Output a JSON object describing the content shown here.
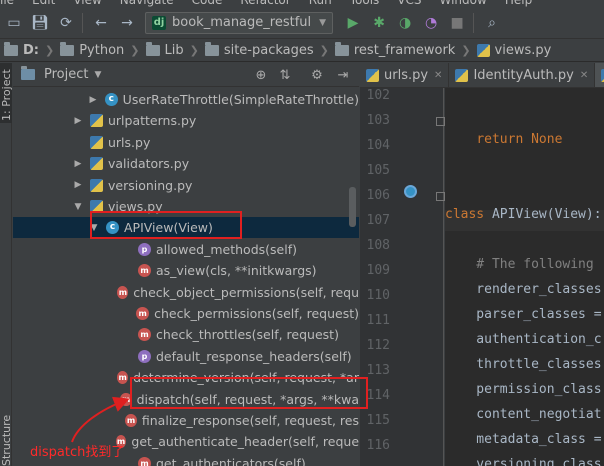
{
  "menubar": {
    "items": [
      "ile",
      "Edit",
      "View",
      "Navigate",
      "Code",
      "Refactor",
      "Run",
      "Tools",
      "VCS",
      "Window",
      "Help"
    ]
  },
  "toolbar": {
    "run_config": "book_manage_restful",
    "run_config_badge": "dj",
    "icons": [
      "save-icon",
      "sync-icon",
      "back-icon",
      "forward-icon",
      "run-icon",
      "debug-icon",
      "coverage-icon",
      "profile-icon",
      "stop-icon",
      "search-icon"
    ]
  },
  "breadcrumb": {
    "items": [
      "D:",
      "Python",
      "Lib",
      "site-packages",
      "rest_framework",
      "views.py"
    ]
  },
  "left_strip": {
    "top_tab": "1: Project",
    "bottom_tab": "Structure"
  },
  "project_panel": {
    "title": "Project",
    "tree": [
      {
        "label": "UserRateThrottle(SimpleRateThrottle)",
        "icon": "c",
        "indent": 108,
        "expander": "▶"
      },
      {
        "label": "urlpatterns.py",
        "icon": "py",
        "indent": 92,
        "expander": "▶"
      },
      {
        "label": "urls.py",
        "icon": "py",
        "indent": 92,
        "expander": ""
      },
      {
        "label": "validators.py",
        "icon": "py",
        "indent": 92,
        "expander": "▶"
      },
      {
        "label": "versioning.py",
        "icon": "py",
        "indent": 92,
        "expander": "▶"
      },
      {
        "label": "views.py",
        "icon": "py",
        "indent": 92,
        "expander": "▼"
      },
      {
        "label": "APIView(View)",
        "icon": "c",
        "indent": 108,
        "expander": "▼",
        "selected": true
      },
      {
        "label": "allowed_methods(self)",
        "icon": "p",
        "indent": 140,
        "expander": ""
      },
      {
        "label": "as_view(cls, **initkwargs)",
        "icon": "m",
        "indent": 140,
        "expander": ""
      },
      {
        "label": "check_object_permissions(self, requ",
        "icon": "m",
        "indent": 140,
        "expander": ""
      },
      {
        "label": "check_permissions(self, request)",
        "icon": "m",
        "indent": 140,
        "expander": ""
      },
      {
        "label": "check_throttles(self, request)",
        "icon": "m",
        "indent": 140,
        "expander": ""
      },
      {
        "label": "default_response_headers(self)",
        "icon": "p",
        "indent": 140,
        "expander": ""
      },
      {
        "label": "determine_version(self, request, *ar",
        "icon": "m",
        "indent": 140,
        "expander": ""
      },
      {
        "label": "dispatch(self, request, *args, **kwa",
        "icon": "m",
        "indent": 140,
        "expander": ""
      },
      {
        "label": "finalize_response(self, request, res",
        "icon": "m",
        "indent": 140,
        "expander": ""
      },
      {
        "label": "get_authenticate_header(self, reque",
        "icon": "m",
        "indent": 140,
        "expander": ""
      },
      {
        "label": "get_authenticators(self)",
        "icon": "m",
        "indent": 140,
        "expander": ""
      }
    ]
  },
  "annotation": {
    "text": "dispatch找到了",
    "color": "#ff2a2a"
  },
  "editor": {
    "tabs": [
      {
        "label": "urls.py",
        "active": false
      },
      {
        "label": "IdentityAuth.py",
        "active": false
      },
      {
        "label": "",
        "active": true
      }
    ],
    "lines": [
      {
        "num": "102",
        "code": ""
      },
      {
        "num": "103",
        "code": "    return None",
        "kind": "return"
      },
      {
        "num": "104",
        "code": ""
      },
      {
        "num": "105",
        "code": ""
      },
      {
        "num": "106",
        "code": "class APIView(View):",
        "kind": "class"
      },
      {
        "num": "107",
        "code": ""
      },
      {
        "num": "108",
        "code": "    # The following",
        "kind": "comment"
      },
      {
        "num": "109",
        "code": "    renderer_classes",
        "kind": "plain"
      },
      {
        "num": "110",
        "code": "    parser_classes =",
        "kind": "plain"
      },
      {
        "num": "111",
        "code": "    authentication_c",
        "kind": "plain"
      },
      {
        "num": "112",
        "code": "    throttle_classes",
        "kind": "plain"
      },
      {
        "num": "113",
        "code": "    permission_class",
        "kind": "plain"
      },
      {
        "num": "114",
        "code": "    content_negotiat",
        "kind": "plain"
      },
      {
        "num": "115",
        "code": "    metadata_class =",
        "kind": "plain"
      },
      {
        "num": "116",
        "code": "    versioning_class",
        "kind": "plain"
      }
    ]
  },
  "colors": {
    "accent": "#0d293e",
    "annotation": "#e02020"
  }
}
